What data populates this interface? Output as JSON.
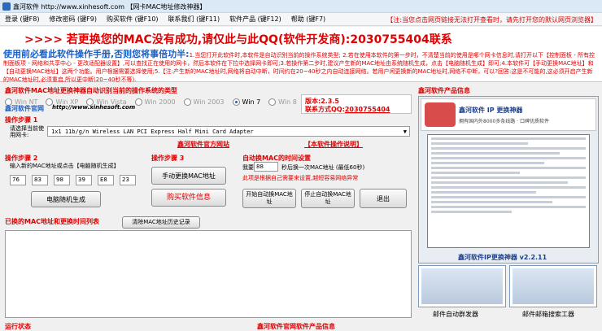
{
  "window": {
    "title": "鑫河软件 http://www.xinhesoft.com 【网卡MAC地址修改神器】"
  },
  "menu": {
    "items": [
      "登录 (键F8)",
      "修改密码 (键F9)",
      "购买软件 (键F10)",
      "联系我们 (键F11)",
      "软件产品 (键F12)",
      "帮助 (键F7)"
    ],
    "notice": "【注:当您点击网页链接无法打开查看时，请先打开您的默认网页浏览器】"
  },
  "banner": {
    "text": ">>>> 若更换您的MAC没有成功,请仅此与此QQ(软件开发商):2030755404联系"
  },
  "manual": {
    "lead": "使用前必看此软件操作手册,否则您将事倍功半:",
    "body": "1.当您打开此软件时,本软件是自动识别当前的操作系统类型; 2.若在使用本软件的第一步时，不清楚当前的使用是哪个网卡信息时,请打开以下【控制面板 - 所有控制面板项 - 网络和共享中心 - 更改适配器设置】,可以查找正在使用的网卡，然后本软件在下拉中选择网卡即可;3.若操作第二步时,建议产生新的MAC地址由系统随机生成，点击【电脑随机生成】即可;4.本软件可【手动更换MAC地址】和【自动更换MAC地址】这两个功能。用户根据需要选择使用;5.【注:产生新的MAC地址时,网络将自动中断，时间约在20~40秒之内自动连接网络。若用户闲更换新的MAC地址时,网络不中断，可以?回答:这是不可能的,这必须开启产生新的MAC地址时,必须重启,所以更中断(20~40秒不等)."
  },
  "os_section": {
    "label": "鑫河软件MAC地址更换神器自动识别当前的操作系统的类型",
    "options": [
      "Win NT",
      "Win XP",
      "Win Vista",
      "Win 2000",
      "Win 2003",
      "Win 7",
      "Win 8"
    ],
    "selected": "Win 7"
  },
  "site": {
    "label": "鑫河软件官网",
    "url": "http://www.xinhesoft.com"
  },
  "version": {
    "text": "版本:2.3.5",
    "contact_label": "联系方式QQ:",
    "contact_value": "2030755404"
  },
  "step1": {
    "label": "操作步骤 1",
    "sub": "请选择当前使用网卡:",
    "adapter": "1x1 11b/g/n Wireless LAN PCI Express Half Mini Card Adapter",
    "official_site": "鑫河软件官方网站",
    "manual_link": "【本软件操作说明】"
  },
  "step2": {
    "label": "操作步骤 2",
    "sub": "输入新的MAC地址或点击【电脑随机生成】",
    "mac": [
      "76",
      "83",
      "98",
      "39",
      "E8",
      "23"
    ],
    "random_button": "电脑随机生成"
  },
  "step3": {
    "label": "操作步骤 3",
    "change_button": "手动更换MAC地址",
    "buy_button": "购买软件信息"
  },
  "auto": {
    "label": "自动换MAC的时间设置",
    "every": "我要",
    "interval": "88",
    "interval_text": "秒后换一次MAC地址 (最低60秒)",
    "hint": "此项是根据自己需要来设置,越短容易网络异常",
    "start_button": "开始自动换MAC地址",
    "stop_button": "停止自动换MAC地址",
    "exit_button": "退出"
  },
  "history": {
    "label": "已换的MAC地址和更换时间列表",
    "clear_button": "清除MAC地址历史记录"
  },
  "status": {
    "label": "运行状态",
    "products_label": "鑫河软件官网软件产品信息"
  },
  "products": {
    "title": "鑫河软件产品信息",
    "panel_name": "鑫河软件 IP 更换神器",
    "panel_slogan": "拥有国内外8000多条线路 · 口碑优质软件",
    "caption": "鑫河软件IP更换神器 v2.2.11",
    "thumb1": "邮件自动群发器",
    "thumb2": "邮件邮箱搜索工器"
  }
}
